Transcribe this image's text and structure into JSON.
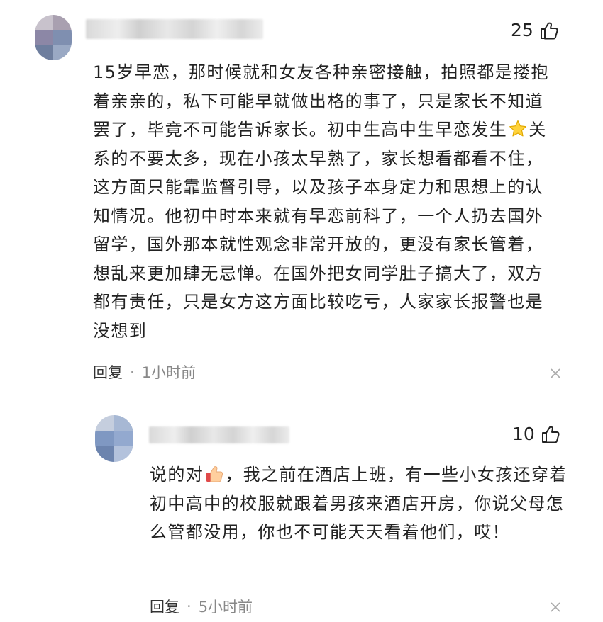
{
  "comments": [
    {
      "likes": "25",
      "text_before": "15岁早恋，那时候就和女友各种亲密接触，拍照都是搂抱着亲亲的，私下可能早就做出格的事了，只是家长不知道罢了，毕竟不可能告诉家长。初中生高中生早恋发生",
      "emoji": "star-emoji",
      "text_after": "关系的不要太多，现在小孩太早熟了，家长想看都看不住，这方面只能靠监督引导，以及孩子本身定力和思想上的认知情况。他初中时本来就有早恋前科了，一个人扔去国外留学，国外那本就性观念非常开放的，更没有家长管着，想乱来更加肆无忌惮。在国外把女同学肚子搞大了，双方都有责任，只是女方这方面比较吃亏，人家家长报警也是没想到",
      "reply_label": "回复",
      "separator": "·",
      "time": "1小时前"
    },
    {
      "likes": "10",
      "text_before": "说的对",
      "emoji": "thumbs-up-emoji",
      "text_after": "，我之前在酒店上班，有一些小女孩还穿着初中高中的校服就跟着男孩来酒店开房，你说父母怎么管都没用，你也不可能天天看着他们，哎！",
      "reply_label": "回复",
      "separator": "·",
      "time": "5小时前"
    }
  ],
  "colors": {
    "text": "#222222",
    "meta": "#888888",
    "background": "#ffffff"
  }
}
